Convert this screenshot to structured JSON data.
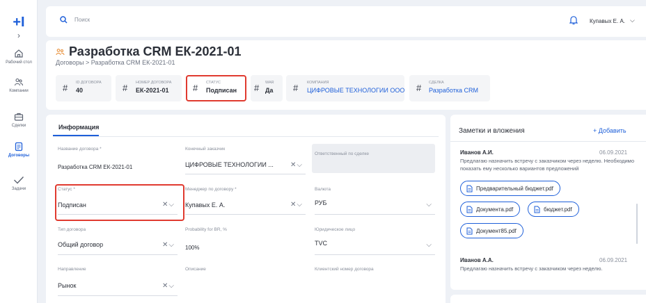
{
  "app": {
    "logo": "+I",
    "brand_color": "#1e5fd9",
    "highlight_color": "#e03a2f"
  },
  "sidebar": {
    "collapse_icon": "chevron-right-icon",
    "items": [
      {
        "label": "Рабочий стол",
        "icon": "home-icon",
        "active": false
      },
      {
        "label": "Компании",
        "icon": "people-icon",
        "active": false
      },
      {
        "label": "Сделки",
        "icon": "briefcase-icon",
        "active": false
      },
      {
        "label": "Договоры",
        "icon": "document-icon",
        "active": true
      },
      {
        "label": "Задачи",
        "icon": "checkmark-icon",
        "active": false
      }
    ]
  },
  "header": {
    "search_placeholder": "Поиск",
    "user_name": "Купавых Е. А."
  },
  "page": {
    "title": "Разработка CRM ЕК-2021-01",
    "breadcrumb": "Договоры  >  Разработка CRM ЕК-2021-01",
    "chips": [
      {
        "label": "ID договора",
        "value": "40"
      },
      {
        "label": "Номер договора",
        "value": "ЕК-2021-01"
      },
      {
        "label": "Статус",
        "value": "Подписан"
      },
      {
        "label": "WAR",
        "value": "Да"
      },
      {
        "label": "Компания",
        "value": "ЦИФРОВЫЕ ТЕХНОЛОГИИ ООО"
      },
      {
        "label": "Сделка",
        "value": "Разработка CRM"
      }
    ]
  },
  "info": {
    "tab": "Информация",
    "fields": {
      "contract_name": {
        "label": "Название договора *",
        "value": "Разработка CRM ЕК-2021-01"
      },
      "end_customer": {
        "label": "Конечный заказчик",
        "value": "ЦИФРОВЫЕ ТЕХНОЛОГИИ ..."
      },
      "responsible": {
        "label": "Ответственный по сделке",
        "value": ""
      },
      "status": {
        "label": "Статус *",
        "value": "Подписан"
      },
      "manager": {
        "label": "Менеджер по договору *",
        "value": "Купавых Е. А."
      },
      "currency": {
        "label": "Валюта",
        "value": "РУБ"
      },
      "contract_type": {
        "label": "Тип договора",
        "value": "Общий договор"
      },
      "probability": {
        "label": "Probability for BR, %",
        "value": "100%"
      },
      "legal_entity": {
        "label": "Юридическое лицо",
        "value": "TVC"
      },
      "direction": {
        "label": "Направление",
        "value": "Рынок"
      },
      "description": {
        "label": "Описание",
        "value": ""
      },
      "client_number": {
        "label": "Клиентский номер договора",
        "value": ""
      }
    }
  },
  "notes": {
    "title": "Заметки и вложения",
    "add_label": "+ Добавить",
    "items": [
      {
        "author": "Иванов А.И.",
        "date": "06.09.2021",
        "text": "Предлагаю назначить встречу с заказчиком через неделю. Необходимо показать ему несколько вариантов предложений",
        "files": [
          "Предварительный бюджет.pdf",
          "Документа.pdf",
          "бюджет.pdf",
          "Документ85.pdf"
        ]
      },
      {
        "author": "Иванов А.А.",
        "date": "06.09.2021",
        "text": "Предлагаю назначить встречу с заказчиком через неделю."
      }
    ]
  }
}
